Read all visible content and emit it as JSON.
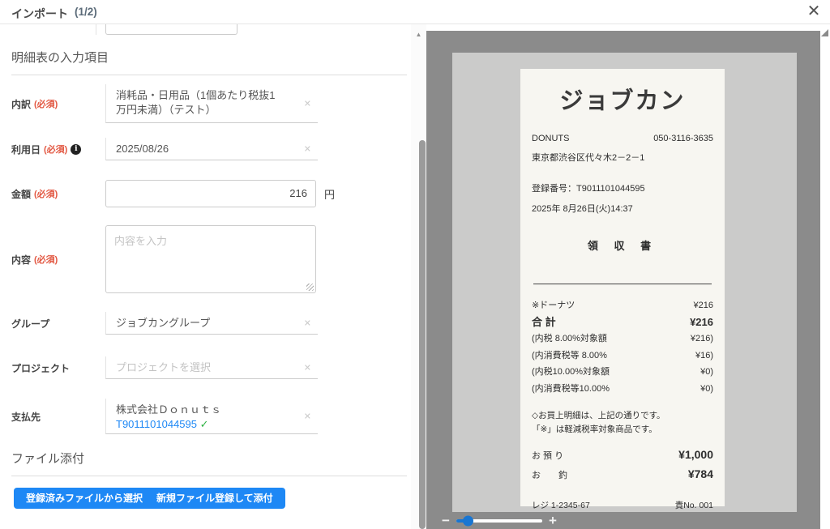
{
  "header": {
    "title": "インポート",
    "page_indicator": "(1/2)"
  },
  "icons": {
    "close": "✕",
    "clear": "✕",
    "info": "i",
    "check": "✓",
    "scroll_up": "▲",
    "zoom_out": "−",
    "zoom_in": "+"
  },
  "form": {
    "section_title": "明細表の入力項目",
    "required_text": "(必須)",
    "fields": {
      "breakdown": {
        "label": "内訳",
        "value": "消耗品・日用品（1個あたり税抜1万円未満）（テスト）"
      },
      "usage_date": {
        "label": "利用日",
        "value": "2025/08/26"
      },
      "amount": {
        "label": "金額",
        "value": "216",
        "unit": "円"
      },
      "description": {
        "label": "内容",
        "placeholder": "内容を入力"
      },
      "group": {
        "label": "グループ",
        "value": "ジョブカングループ"
      },
      "project": {
        "label": "プロジェクト",
        "placeholder": "プロジェクトを選択"
      },
      "payee": {
        "label": "支払先",
        "value_line1": "株式会社Ｄｏｎｕｔｓ",
        "value_line2": "T9011101044595"
      }
    },
    "attachment_section_title": "ファイル添付",
    "buttons": {
      "select_existing": "登録済みファイルから選択",
      "register_new": "新規ファイル登録して添付"
    }
  },
  "receipt": {
    "logo": "ジョブカン",
    "store_name": "DONUTS",
    "phone": "050-3116-3635",
    "address": "東京都渋谷区代々木2－2－1",
    "registration_number": "登録番号：T9011101044595",
    "datetime": "2025年  8月26日(火)14:37",
    "doc_title": "領 収 書",
    "rows": [
      {
        "name": "※ドーナツ",
        "amount": "¥216"
      },
      {
        "name": "合  計",
        "amount": "¥216"
      },
      {
        "name": "(内税  8.00%対象額",
        "amount": "¥216)"
      },
      {
        "name": "(内消費税等  8.00%",
        "amount": "¥16)"
      },
      {
        "name": "(内税10.00%対象額",
        "amount": "¥0)"
      },
      {
        "name": "(内消費税等10.00%",
        "amount": "¥0)"
      }
    ],
    "note1": "◇お買上明細は、上記の通りです。",
    "note2": "「※」は軽減税率対象商品です。",
    "deposit": {
      "label": "お 預 り",
      "amount": "¥1,000"
    },
    "change": {
      "label": "お　　釣",
      "amount": "¥784"
    },
    "footer_left": "レジ  1-2345-67",
    "footer_right": "責No. 001"
  },
  "colors": {
    "accent_blue": "#1e88f5",
    "required_red": "#e25741",
    "check_green": "#2fb344",
    "panel_gray": "#8b8b8b",
    "slider_blue": "#1976d2"
  }
}
